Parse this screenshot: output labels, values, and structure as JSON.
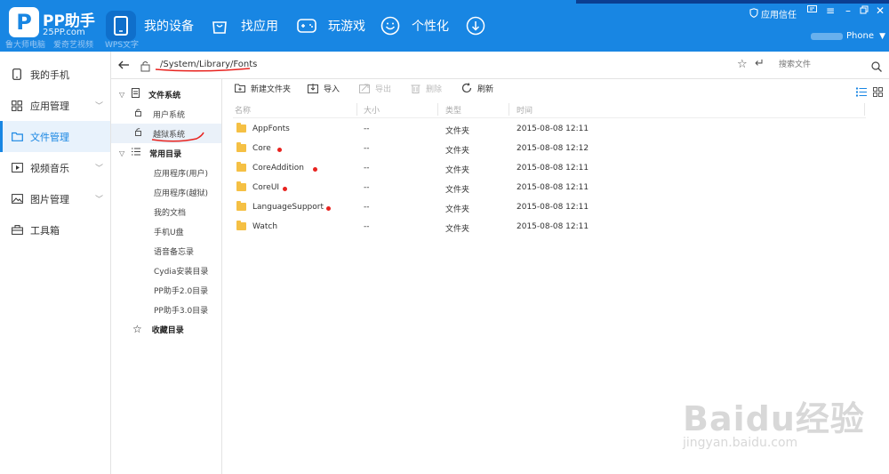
{
  "app": {
    "title": "PP助手",
    "subtitle": "25PP.com"
  },
  "ghost_labels": [
    "鲁大师电脑",
    "爱奇艺视频",
    "WPS文字"
  ],
  "nav": [
    {
      "label": "我的设备",
      "icon": "phone-icon",
      "active": true
    },
    {
      "label": "找应用",
      "icon": "bag-icon",
      "active": false
    },
    {
      "label": "玩游戏",
      "icon": "gamepad-icon",
      "active": false
    },
    {
      "label": "个性化",
      "icon": "smiley-icon",
      "active": false
    },
    {
      "label": "",
      "icon": "download-icon",
      "active": false
    }
  ],
  "topright": {
    "trust_label": "应用信任",
    "device_label": "Phone"
  },
  "sidebar": {
    "items": [
      {
        "label": "我的手机",
        "icon": "phone-icon"
      },
      {
        "label": "应用管理",
        "icon": "apps-icon"
      },
      {
        "label": "文件管理",
        "icon": "folder-icon"
      },
      {
        "label": "视频音乐",
        "icon": "media-icon"
      },
      {
        "label": "图片管理",
        "icon": "image-icon"
      },
      {
        "label": "工具箱",
        "icon": "toolbox-icon"
      }
    ]
  },
  "pathbar": {
    "path": "/System/Library/Fonts",
    "search_placeholder": "搜索文件"
  },
  "tree": {
    "filesystem": "文件系统",
    "user_system": "用户系统",
    "jailbreak_system": "越狱系统",
    "common_dirs": "常用目录",
    "items": [
      "应用程序(用户)",
      "应用程序(越狱)",
      "我的文档",
      "手机U盘",
      "语音备忘录",
      "Cydia安装目录",
      "PP助手2.0目录",
      "PP助手3.0目录"
    ],
    "favorites": "收藏目录"
  },
  "toolbar": {
    "new_folder": "新建文件夹",
    "import": "导入",
    "export": "导出",
    "delete": "删除",
    "refresh": "刷新"
  },
  "table": {
    "headers": {
      "name": "名称",
      "size": "大小",
      "type": "类型",
      "time": "时间"
    },
    "rows": [
      {
        "name": "AppFonts",
        "size": "--",
        "type": "文件夹",
        "time": "2015-08-08 12:11",
        "marked": false
      },
      {
        "name": "Core",
        "size": "--",
        "type": "文件夹",
        "time": "2015-08-08 12:12",
        "marked": true
      },
      {
        "name": "CoreAddition",
        "size": "--",
        "type": "文件夹",
        "time": "2015-08-08 12:11",
        "marked": true
      },
      {
        "name": "CoreUI",
        "size": "--",
        "type": "文件夹",
        "time": "2015-08-08 12:11",
        "marked": true
      },
      {
        "name": "LanguageSupport",
        "size": "--",
        "type": "文件夹",
        "time": "2015-08-08 12:11",
        "marked": true
      },
      {
        "name": "Watch",
        "size": "--",
        "type": "文件夹",
        "time": "2015-08-08 12:11",
        "marked": false
      }
    ]
  },
  "watermark": {
    "logo": "Baidu经验",
    "url": "jingyan.baidu.com"
  },
  "colors": {
    "brand": "#1886e3",
    "annotation_red": "#e8231f"
  }
}
